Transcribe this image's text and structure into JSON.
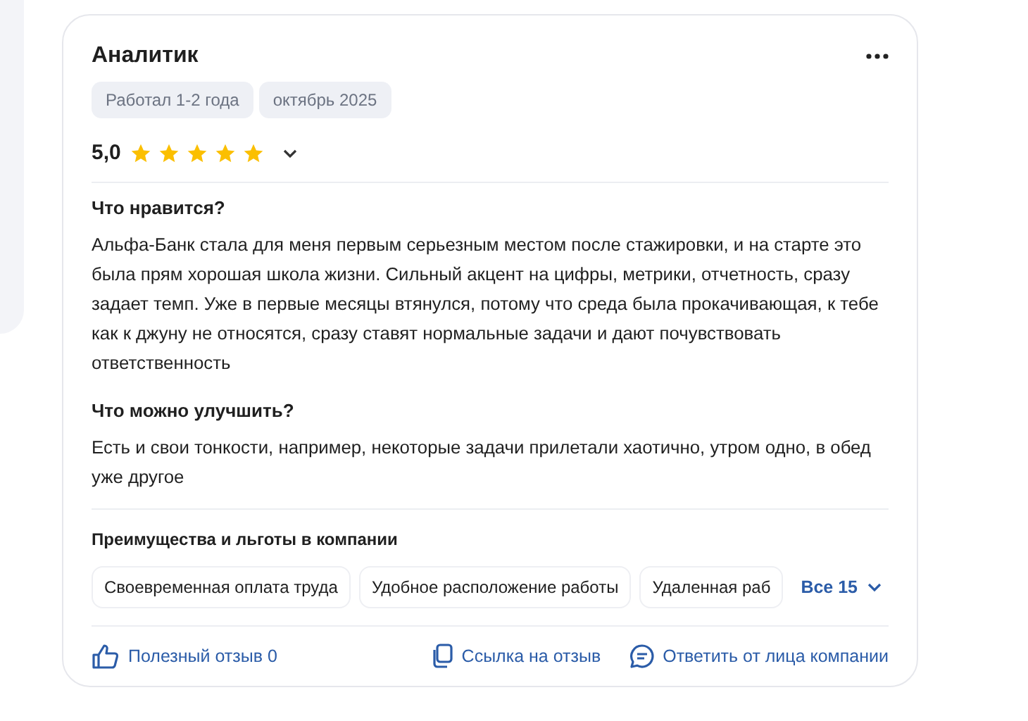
{
  "review": {
    "title": "Аналитик",
    "tags": [
      "Работал 1-2 года",
      "октябрь 2025"
    ],
    "rating": "5,0",
    "stars": 5,
    "sections": [
      {
        "heading": "Что нравится?",
        "text": "Альфа-Банк стала для меня первым серьезным местом после стажировки, и на старте это была прям хорошая школа жизни. Сильный акцент на цифры, метрики, отчетность, сразу задает темп. Уже в первые месяцы втянулся, потому что среда была прокачивающая, к тебе как к джуну не относятся, сразу ставят нормальные задачи и дают почувствовать ответственность"
      },
      {
        "heading": "Что можно улучшить?",
        "text": "Есть и свои тонкости, например, некоторые задачи прилетали хаотично, утром одно, в обед уже другое"
      }
    ],
    "benefits": {
      "heading": "Преимущества и льготы в компании",
      "items": [
        "Своевременная оплата труда",
        "Удобное расположение работы",
        "Удаленная раб"
      ],
      "more": "Все 15"
    },
    "actions": [
      {
        "kind": "like",
        "label": "Полезный отзыв 0"
      },
      {
        "kind": "link",
        "label": "Ссылка на отзыв"
      },
      {
        "kind": "reply",
        "label": "Ответить от лица компании"
      }
    ]
  }
}
